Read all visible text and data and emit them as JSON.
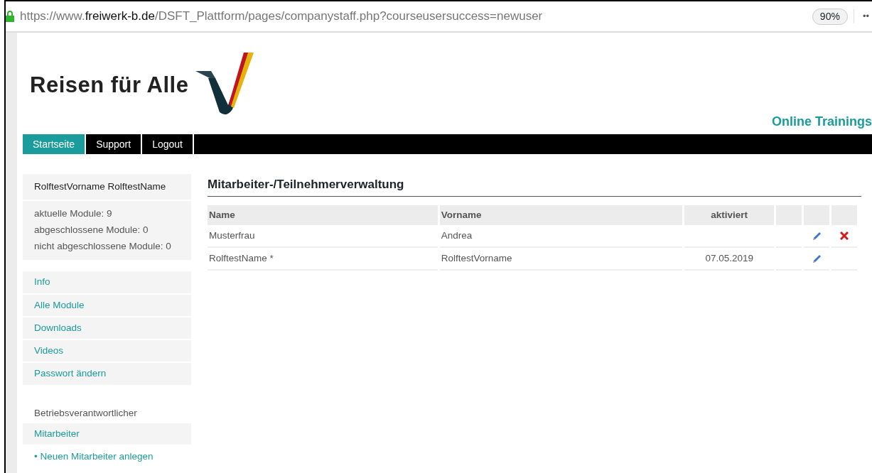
{
  "browser": {
    "url_prefix": "https://www.",
    "url_domain": "freiwerk-b.de",
    "url_path": "/DSFT_Plattform/pages/companystaff.php?courseusersuccess=newuser",
    "zoom": "90%",
    "menu": "••"
  },
  "header": {
    "logo_text": "Reisen für Alle",
    "tagline": "Online Trainings"
  },
  "nav": [
    {
      "label": "Startseite",
      "selected": true
    },
    {
      "label": "Support",
      "selected": false
    },
    {
      "label": "Logout",
      "selected": false
    }
  ],
  "sidebar": {
    "user_name": "RolftestVorname RolftestName",
    "stats": [
      "aktuelle Module: 9",
      "abgeschlossene Module: 0",
      "nicht abgeschlossene Module: 0"
    ],
    "links": [
      "Info",
      "Alle Module",
      "Downloads",
      "Videos",
      "Passwort ändern"
    ],
    "section_label": "Betriebsverantwortlicher",
    "section_link": "Mitarbeiter",
    "sub_link": "• Neuen Mitarbeiter anlegen"
  },
  "main": {
    "title": "Mitarbeiter-/Teilnehmerverwaltung",
    "table": {
      "columns": [
        "Name",
        "Vorname",
        "aktiviert"
      ],
      "rows": [
        {
          "name": "Musterfrau",
          "vorname": "Andrea",
          "aktiviert": "",
          "editable": true,
          "deletable": true
        },
        {
          "name": "RolftestName *",
          "vorname": "RolftestVorname",
          "aktiviert": "07.05.2019",
          "editable": true,
          "deletable": false
        }
      ]
    }
  }
}
